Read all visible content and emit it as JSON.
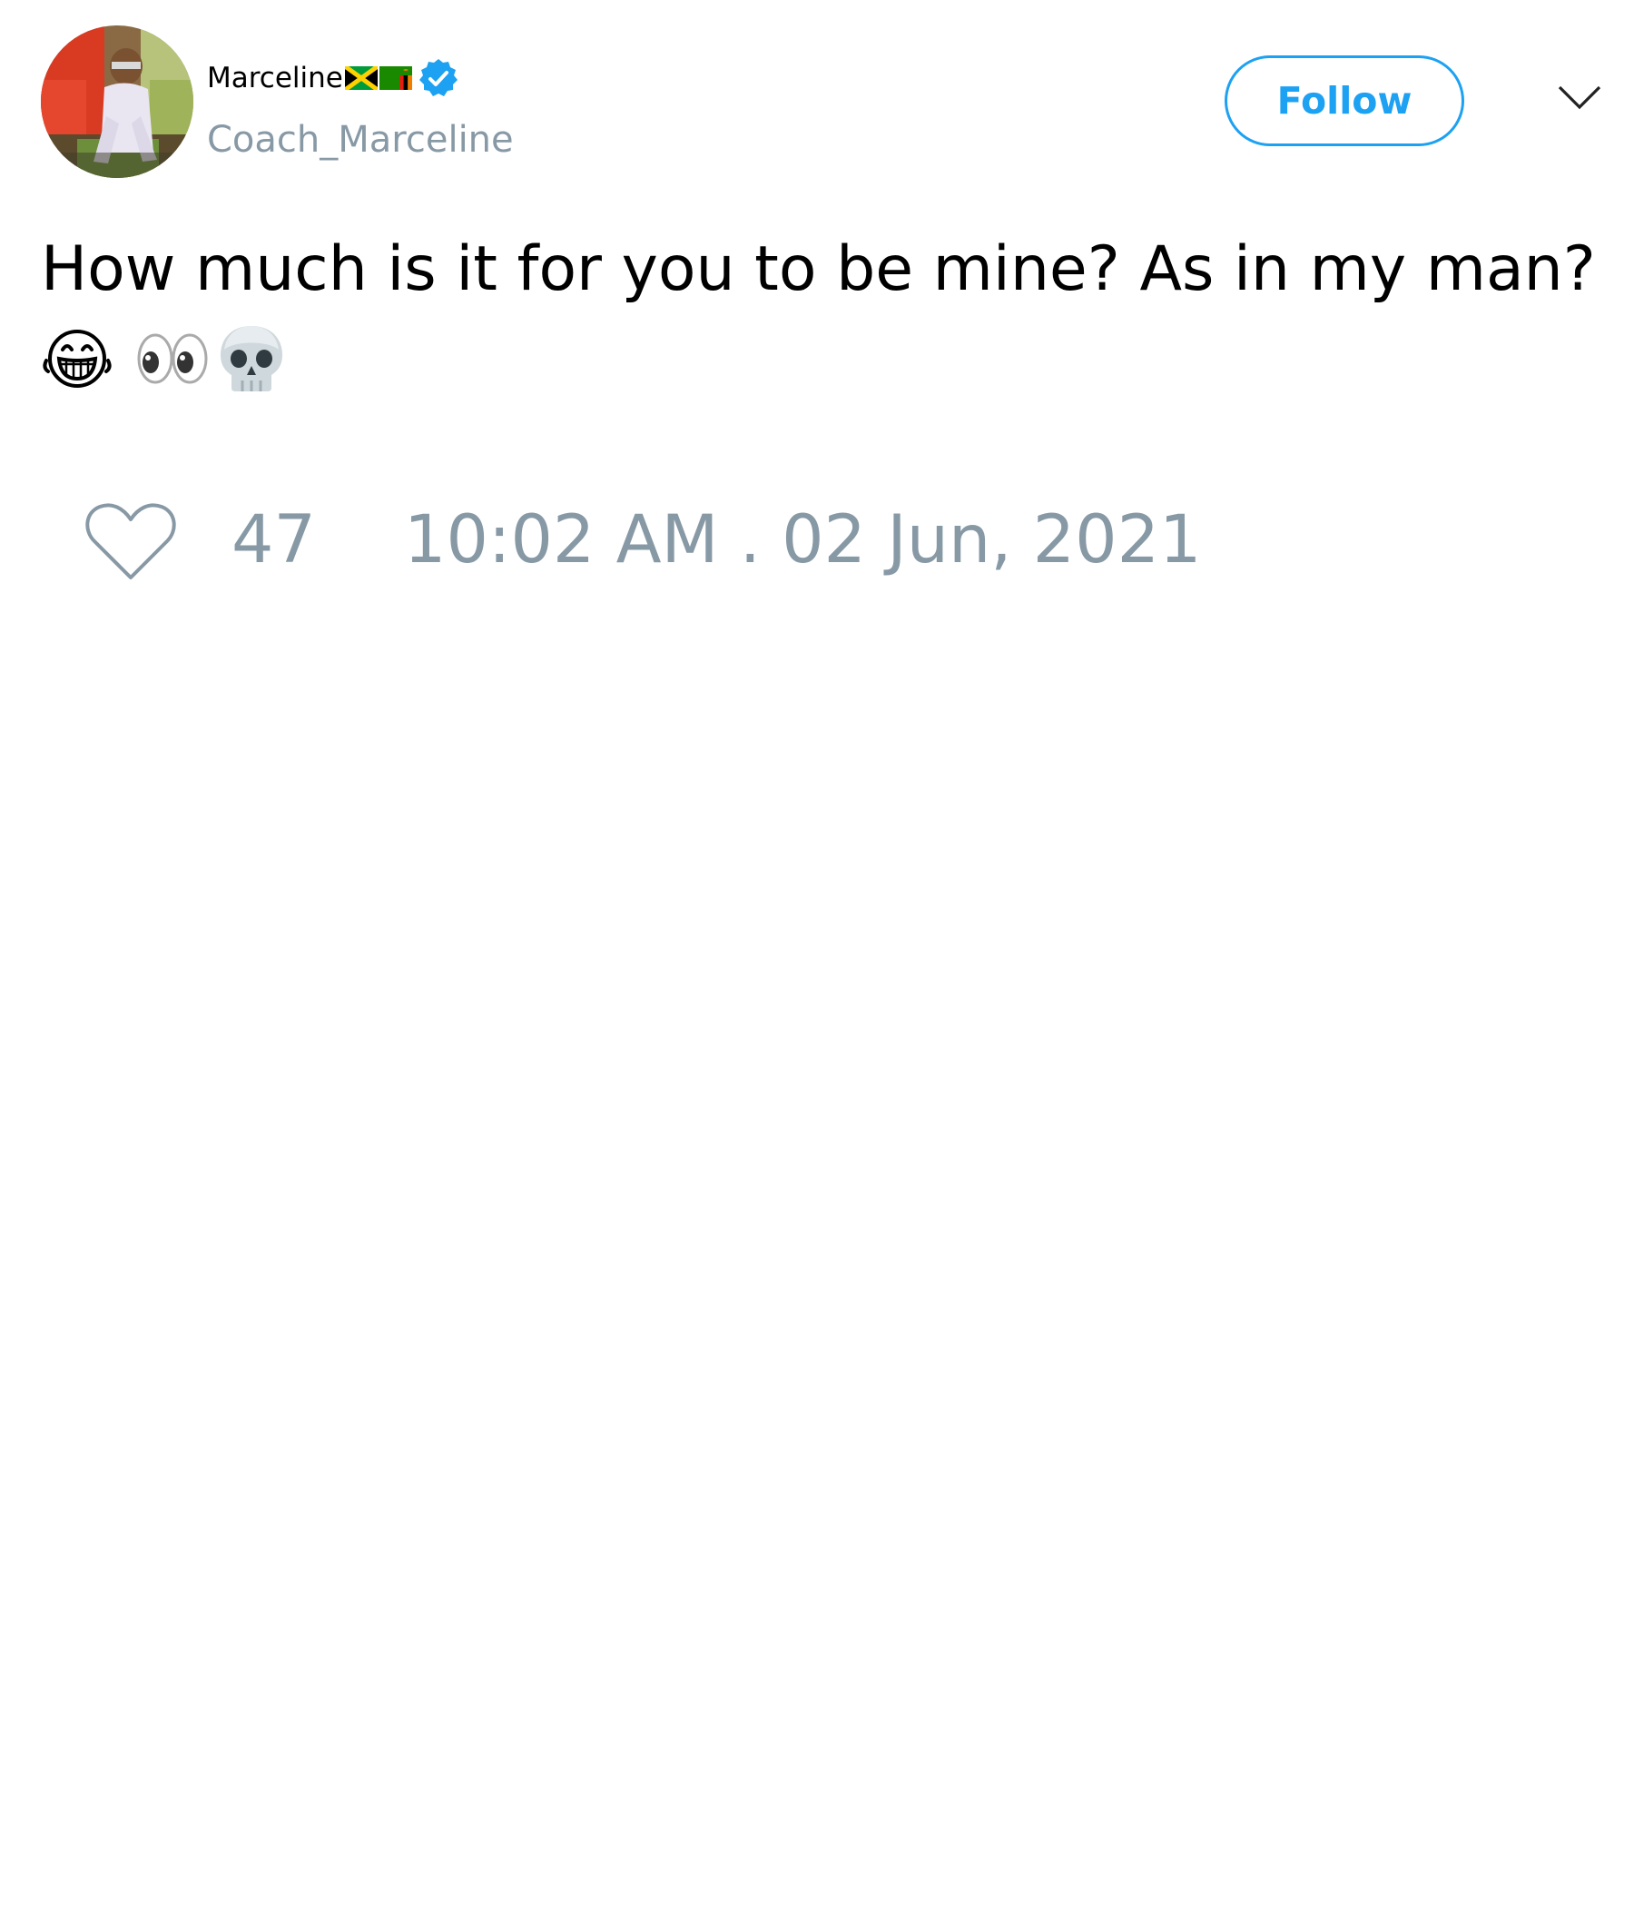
{
  "tweet": {
    "author": {
      "display_name": "Marceline",
      "flags": [
        "jamaica-flag",
        "zambia-flag"
      ],
      "verified": true,
      "handle": "Coach_Marceline"
    },
    "follow_label": "Follow",
    "text": "How much is it for you to be mine? As in my man?",
    "emojis": [
      "laughing-face-icon",
      "eyes-icon",
      "skull-icon"
    ],
    "likes": "47",
    "timestamp": "10:02 AM . 02 Jun, 2021"
  },
  "colors": {
    "accent": "#1da1f2",
    "muted_text": "#8899a6",
    "text": "#000000"
  }
}
